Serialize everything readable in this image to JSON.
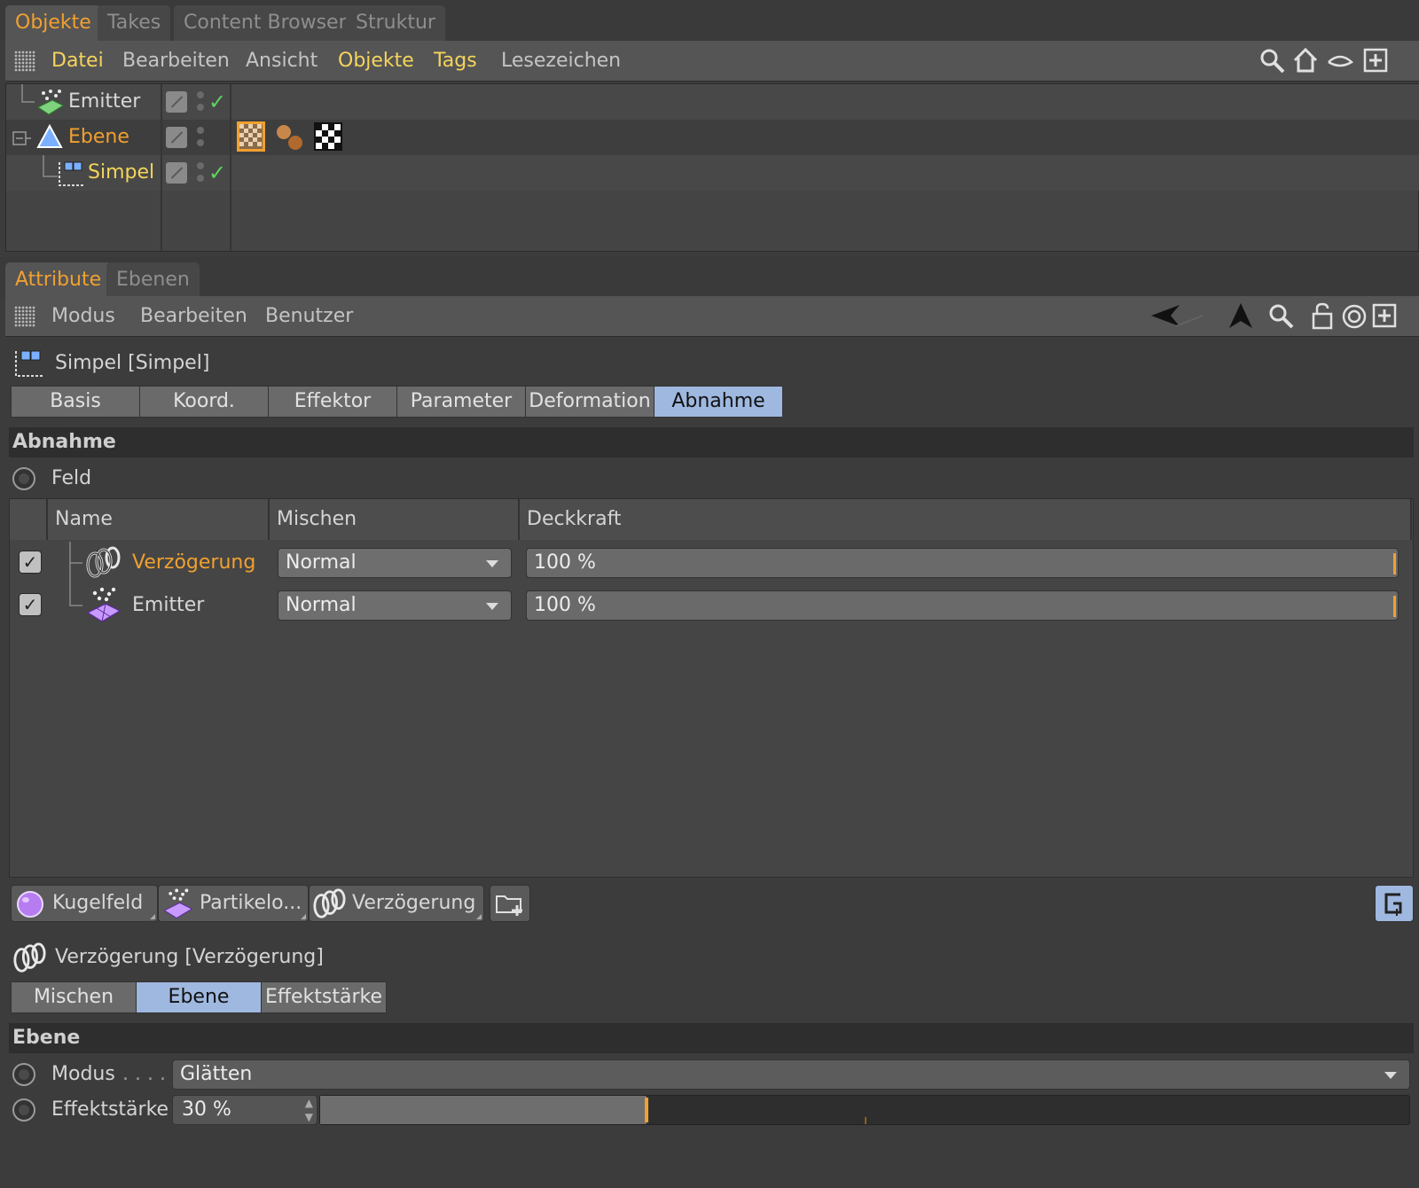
{
  "top_tabs": [
    "Objekte",
    "Takes",
    "Content Browser",
    "Struktur"
  ],
  "obj_menu": [
    "Datei",
    "Bearbeiten",
    "Ansicht",
    "Objekte",
    "Tags",
    "Lesezeichen"
  ],
  "objects": [
    {
      "name": "Emitter",
      "color": "#d8d8d8"
    },
    {
      "name": "Ebene",
      "color": "#f0a030"
    },
    {
      "name": "Simpel",
      "color": "#f5d45c"
    }
  ],
  "attr_tabs": [
    "Attribute",
    "Ebenen"
  ],
  "attr_menu": [
    "Modus",
    "Bearbeiten",
    "Benutzer"
  ],
  "attr_title": "Simpel [Simpel]",
  "sub_tabs": [
    "Basis",
    "Koord.",
    "Effektor",
    "Parameter",
    "Deformation",
    "Abnahme"
  ],
  "section1": "Abnahme",
  "feld_label": "Feld",
  "columns": [
    "Name",
    "Mischen",
    "Deckkraft"
  ],
  "field_rows": [
    {
      "name": "Verzögerung",
      "blend": "Normal",
      "opacity": "100 %",
      "color": "#f0a030"
    },
    {
      "name": "Emitter",
      "blend": "Normal",
      "opacity": "100 %",
      "color": "#d8d8d8"
    }
  ],
  "field_buttons": [
    "Kugelfeld",
    "Partikelo...",
    "Verzögerung"
  ],
  "sub_title": "Verzögerung [Verzögerung]",
  "sub_tabs2": [
    "Mischen",
    "Ebene",
    "Effektstärke"
  ],
  "section2": "Ebene",
  "modus_label": "Modus",
  "modus_dots": ". . . .",
  "modus_value": "Glätten",
  "staerke_label": "Effektstärke",
  "staerke_value": "30 %",
  "staerke_fraction": 0.3,
  "accent_color": "#f0a030",
  "selected_tab_color": "#9fb8e0"
}
